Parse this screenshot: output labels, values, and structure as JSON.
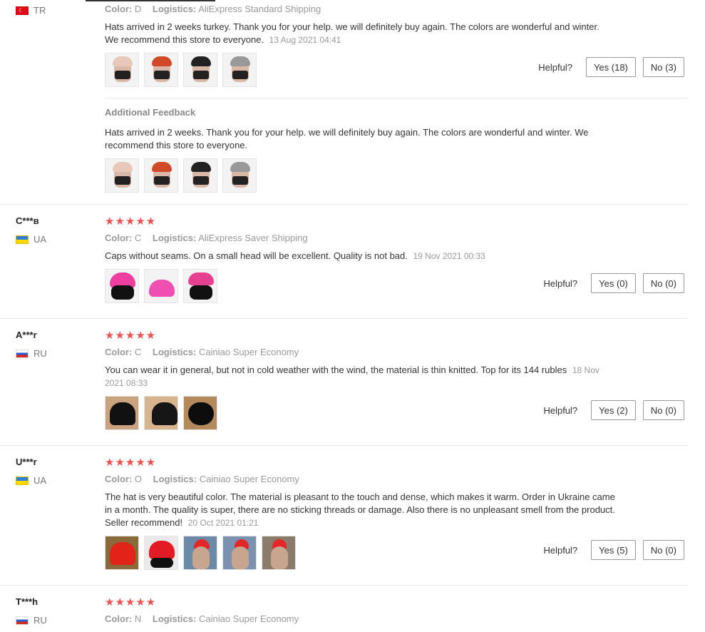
{
  "labels": {
    "color": "Color:",
    "logistics": "Logistics:",
    "helpful": "Helpful?",
    "additional_feedback": "Additional Feedback"
  },
  "reviews": [
    {
      "user": "",
      "country": "TR",
      "color_value": "D",
      "logistics_value": "AliExpress Standard Shipping",
      "text": "Hats arrived in 2 weeks turkey. Thank you for your help. we will definitely buy again. The colors are wonderful and winter. We recommend this store to everyone.",
      "date": "13 Aug 2021 04:41",
      "yes": "Yes (18)",
      "no": "No (3)",
      "additional_text": "Hats arrived in 2 weeks. Thank you for your help. we will definitely buy again. The colors are wonderful and winter. We recommend this store to everyone."
    },
    {
      "user": "C***в",
      "country": "UA",
      "color_value": "C",
      "logistics_value": "AliExpress Saver Shipping",
      "text": "Caps without seams. On a small head will be excellent. Quality is not bad.",
      "date": "19 Nov 2021 00:33",
      "yes": "Yes (0)",
      "no": "No (0)"
    },
    {
      "user": "A***r",
      "country": "RU",
      "color_value": "C",
      "logistics_value": "Cainiao Super Economy",
      "text": "You can wear it in general, but not in cold weather with the wind, the material is thin knitted. Top for its 144 rubles",
      "date": "18 Nov 2021 08:33",
      "yes": "Yes (2)",
      "no": "No (0)"
    },
    {
      "user": "U***r",
      "country": "UA",
      "color_value": "O",
      "logistics_value": "Cainiao Super Economy",
      "text": "The hat is very beautiful color. The material is pleasant to the touch and dense, which makes it warm. Order in Ukraine came in a month. The quality is super, there are no sticking threads or damage. Also there is no unpleasant smell from the product. Seller recommend!",
      "date": "20 Oct 2021 01:21",
      "yes": "Yes (5)",
      "no": "No (0)"
    },
    {
      "user": "T***h",
      "country": "RU",
      "color_value": "N",
      "logistics_value": "Cainiao Super Economy"
    }
  ],
  "colors": {
    "star": "#f24f4f",
    "meta_gray": "#999999",
    "divider": "#e8e8e8"
  }
}
